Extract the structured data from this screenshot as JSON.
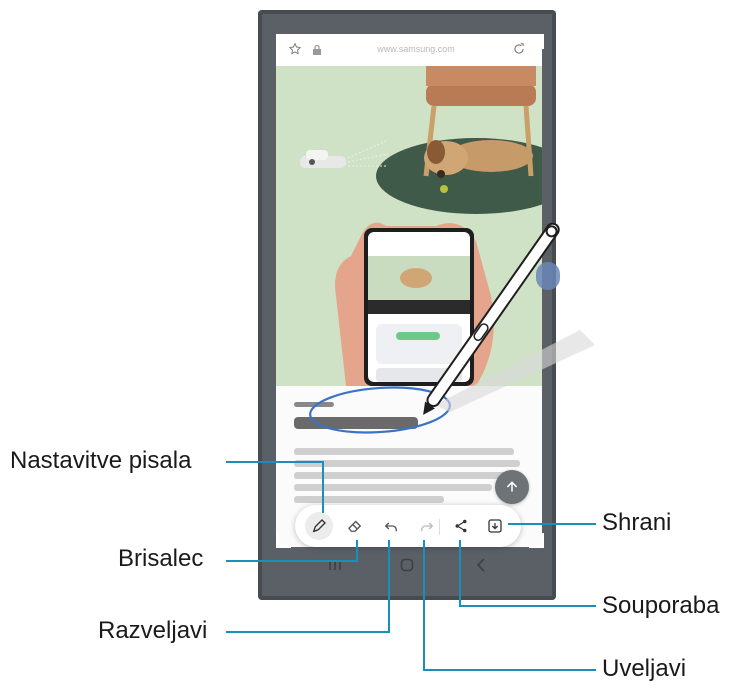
{
  "browser": {
    "url": "www.samsung.com"
  },
  "toolbar": {
    "pen_settings_icon": "pen-icon",
    "eraser_icon": "eraser-icon",
    "undo_icon": "undo-icon",
    "redo_icon": "redo-icon",
    "share_icon": "share-icon",
    "save_icon": "download-icon"
  },
  "callouts": {
    "pen_settings": "Nastavitve pisala",
    "eraser": "Brisalec",
    "undo": "Razveljavi",
    "save": "Shrani",
    "share": "Souporaba",
    "redo": "Uveljavi"
  },
  "colors": {
    "leader_line": "#1a8fbc",
    "hero_background": "#cfe2c6",
    "phone_frame": "#5a6066"
  }
}
